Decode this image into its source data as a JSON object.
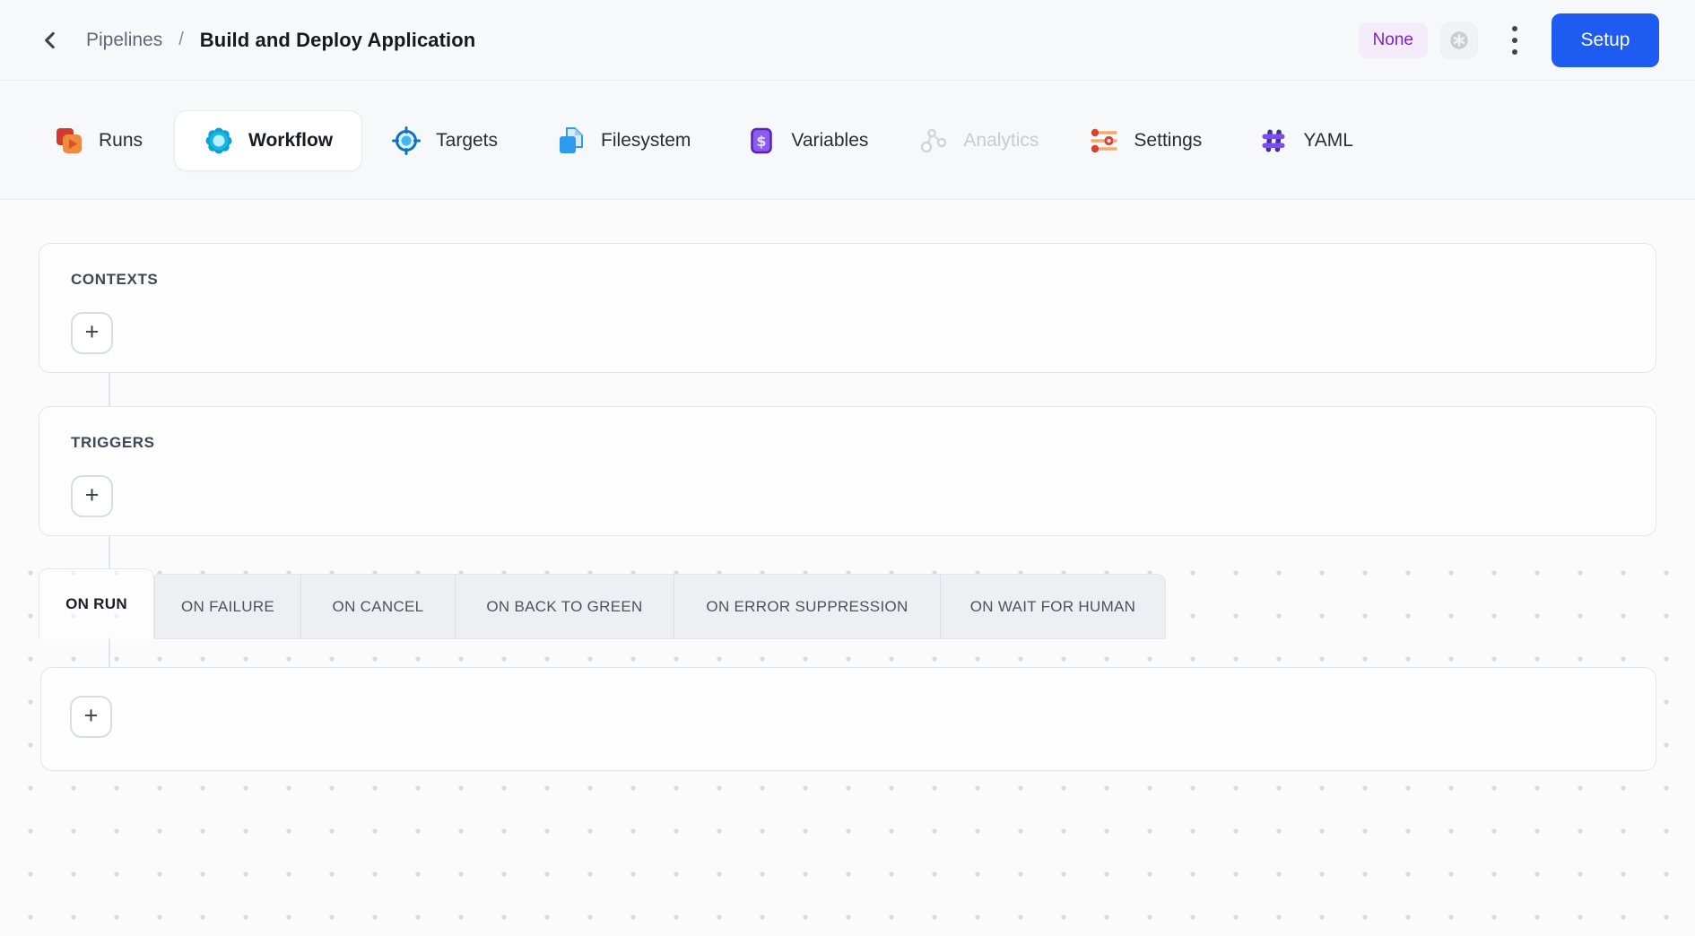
{
  "header": {
    "breadcrumb": {
      "section": "Pipelines",
      "separator": "/",
      "title": "Build and Deploy Application"
    },
    "badge": "None",
    "setup_label": "Setup"
  },
  "nav": {
    "tabs": [
      {
        "label": "Runs",
        "icon": "runs-icon",
        "state": "normal"
      },
      {
        "label": "Workflow",
        "icon": "workflow-icon",
        "state": "active"
      },
      {
        "label": "Targets",
        "icon": "targets-icon",
        "state": "normal"
      },
      {
        "label": "Filesystem",
        "icon": "filesystem-icon",
        "state": "normal"
      },
      {
        "label": "Variables",
        "icon": "variables-icon",
        "state": "normal"
      },
      {
        "label": "Analytics",
        "icon": "analytics-icon",
        "state": "disabled"
      },
      {
        "label": "Settings",
        "icon": "settings-icon",
        "state": "normal"
      },
      {
        "label": "YAML",
        "icon": "yaml-icon",
        "state": "normal"
      }
    ]
  },
  "canvas": {
    "contexts": {
      "label": "CONTEXTS",
      "add_label": "+"
    },
    "triggers": {
      "label": "TRIGGERS",
      "add_label": "+"
    },
    "event_tabs": [
      {
        "label": "ON RUN",
        "state": "active"
      },
      {
        "label": "ON FAILURE",
        "state": "normal"
      },
      {
        "label": "ON CANCEL",
        "state": "normal"
      },
      {
        "label": "ON BACK TO GREEN",
        "state": "normal"
      },
      {
        "label": "ON ERROR SUPPRESSION",
        "state": "normal"
      },
      {
        "label": "ON WAIT FOR HUMAN",
        "state": "normal"
      }
    ],
    "steps": {
      "add_label": "+"
    }
  },
  "colors": {
    "accent_blue": "#1e5bf0",
    "badge_bg": "#f5ecfb",
    "badge_text": "#7b22cf",
    "canvas_dot": "#d7dade"
  }
}
